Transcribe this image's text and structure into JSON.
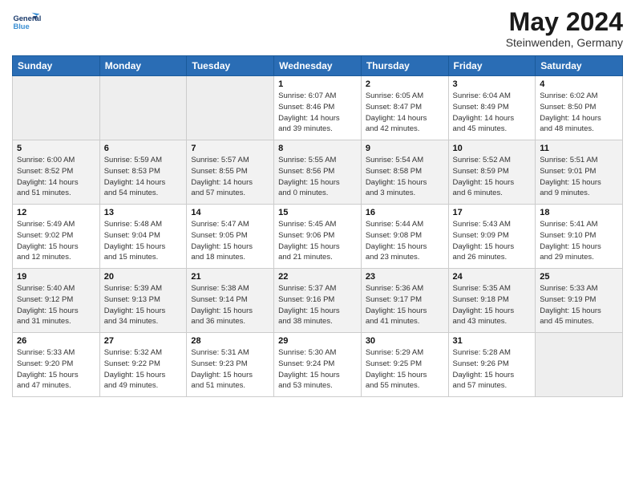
{
  "header": {
    "logo_line1": "General",
    "logo_line2": "Blue",
    "month": "May 2024",
    "location": "Steinwenden, Germany"
  },
  "days_of_week": [
    "Sunday",
    "Monday",
    "Tuesday",
    "Wednesday",
    "Thursday",
    "Friday",
    "Saturday"
  ],
  "weeks": [
    [
      {
        "day": "",
        "info": ""
      },
      {
        "day": "",
        "info": ""
      },
      {
        "day": "",
        "info": ""
      },
      {
        "day": "1",
        "info": "Sunrise: 6:07 AM\nSunset: 8:46 PM\nDaylight: 14 hours\nand 39 minutes."
      },
      {
        "day": "2",
        "info": "Sunrise: 6:05 AM\nSunset: 8:47 PM\nDaylight: 14 hours\nand 42 minutes."
      },
      {
        "day": "3",
        "info": "Sunrise: 6:04 AM\nSunset: 8:49 PM\nDaylight: 14 hours\nand 45 minutes."
      },
      {
        "day": "4",
        "info": "Sunrise: 6:02 AM\nSunset: 8:50 PM\nDaylight: 14 hours\nand 48 minutes."
      }
    ],
    [
      {
        "day": "5",
        "info": "Sunrise: 6:00 AM\nSunset: 8:52 PM\nDaylight: 14 hours\nand 51 minutes."
      },
      {
        "day": "6",
        "info": "Sunrise: 5:59 AM\nSunset: 8:53 PM\nDaylight: 14 hours\nand 54 minutes."
      },
      {
        "day": "7",
        "info": "Sunrise: 5:57 AM\nSunset: 8:55 PM\nDaylight: 14 hours\nand 57 minutes."
      },
      {
        "day": "8",
        "info": "Sunrise: 5:55 AM\nSunset: 8:56 PM\nDaylight: 15 hours\nand 0 minutes."
      },
      {
        "day": "9",
        "info": "Sunrise: 5:54 AM\nSunset: 8:58 PM\nDaylight: 15 hours\nand 3 minutes."
      },
      {
        "day": "10",
        "info": "Sunrise: 5:52 AM\nSunset: 8:59 PM\nDaylight: 15 hours\nand 6 minutes."
      },
      {
        "day": "11",
        "info": "Sunrise: 5:51 AM\nSunset: 9:01 PM\nDaylight: 15 hours\nand 9 minutes."
      }
    ],
    [
      {
        "day": "12",
        "info": "Sunrise: 5:49 AM\nSunset: 9:02 PM\nDaylight: 15 hours\nand 12 minutes."
      },
      {
        "day": "13",
        "info": "Sunrise: 5:48 AM\nSunset: 9:04 PM\nDaylight: 15 hours\nand 15 minutes."
      },
      {
        "day": "14",
        "info": "Sunrise: 5:47 AM\nSunset: 9:05 PM\nDaylight: 15 hours\nand 18 minutes."
      },
      {
        "day": "15",
        "info": "Sunrise: 5:45 AM\nSunset: 9:06 PM\nDaylight: 15 hours\nand 21 minutes."
      },
      {
        "day": "16",
        "info": "Sunrise: 5:44 AM\nSunset: 9:08 PM\nDaylight: 15 hours\nand 23 minutes."
      },
      {
        "day": "17",
        "info": "Sunrise: 5:43 AM\nSunset: 9:09 PM\nDaylight: 15 hours\nand 26 minutes."
      },
      {
        "day": "18",
        "info": "Sunrise: 5:41 AM\nSunset: 9:10 PM\nDaylight: 15 hours\nand 29 minutes."
      }
    ],
    [
      {
        "day": "19",
        "info": "Sunrise: 5:40 AM\nSunset: 9:12 PM\nDaylight: 15 hours\nand 31 minutes."
      },
      {
        "day": "20",
        "info": "Sunrise: 5:39 AM\nSunset: 9:13 PM\nDaylight: 15 hours\nand 34 minutes."
      },
      {
        "day": "21",
        "info": "Sunrise: 5:38 AM\nSunset: 9:14 PM\nDaylight: 15 hours\nand 36 minutes."
      },
      {
        "day": "22",
        "info": "Sunrise: 5:37 AM\nSunset: 9:16 PM\nDaylight: 15 hours\nand 38 minutes."
      },
      {
        "day": "23",
        "info": "Sunrise: 5:36 AM\nSunset: 9:17 PM\nDaylight: 15 hours\nand 41 minutes."
      },
      {
        "day": "24",
        "info": "Sunrise: 5:35 AM\nSunset: 9:18 PM\nDaylight: 15 hours\nand 43 minutes."
      },
      {
        "day": "25",
        "info": "Sunrise: 5:33 AM\nSunset: 9:19 PM\nDaylight: 15 hours\nand 45 minutes."
      }
    ],
    [
      {
        "day": "26",
        "info": "Sunrise: 5:33 AM\nSunset: 9:20 PM\nDaylight: 15 hours\nand 47 minutes."
      },
      {
        "day": "27",
        "info": "Sunrise: 5:32 AM\nSunset: 9:22 PM\nDaylight: 15 hours\nand 49 minutes."
      },
      {
        "day": "28",
        "info": "Sunrise: 5:31 AM\nSunset: 9:23 PM\nDaylight: 15 hours\nand 51 minutes."
      },
      {
        "day": "29",
        "info": "Sunrise: 5:30 AM\nSunset: 9:24 PM\nDaylight: 15 hours\nand 53 minutes."
      },
      {
        "day": "30",
        "info": "Sunrise: 5:29 AM\nSunset: 9:25 PM\nDaylight: 15 hours\nand 55 minutes."
      },
      {
        "day": "31",
        "info": "Sunrise: 5:28 AM\nSunset: 9:26 PM\nDaylight: 15 hours\nand 57 minutes."
      },
      {
        "day": "",
        "info": ""
      }
    ]
  ]
}
